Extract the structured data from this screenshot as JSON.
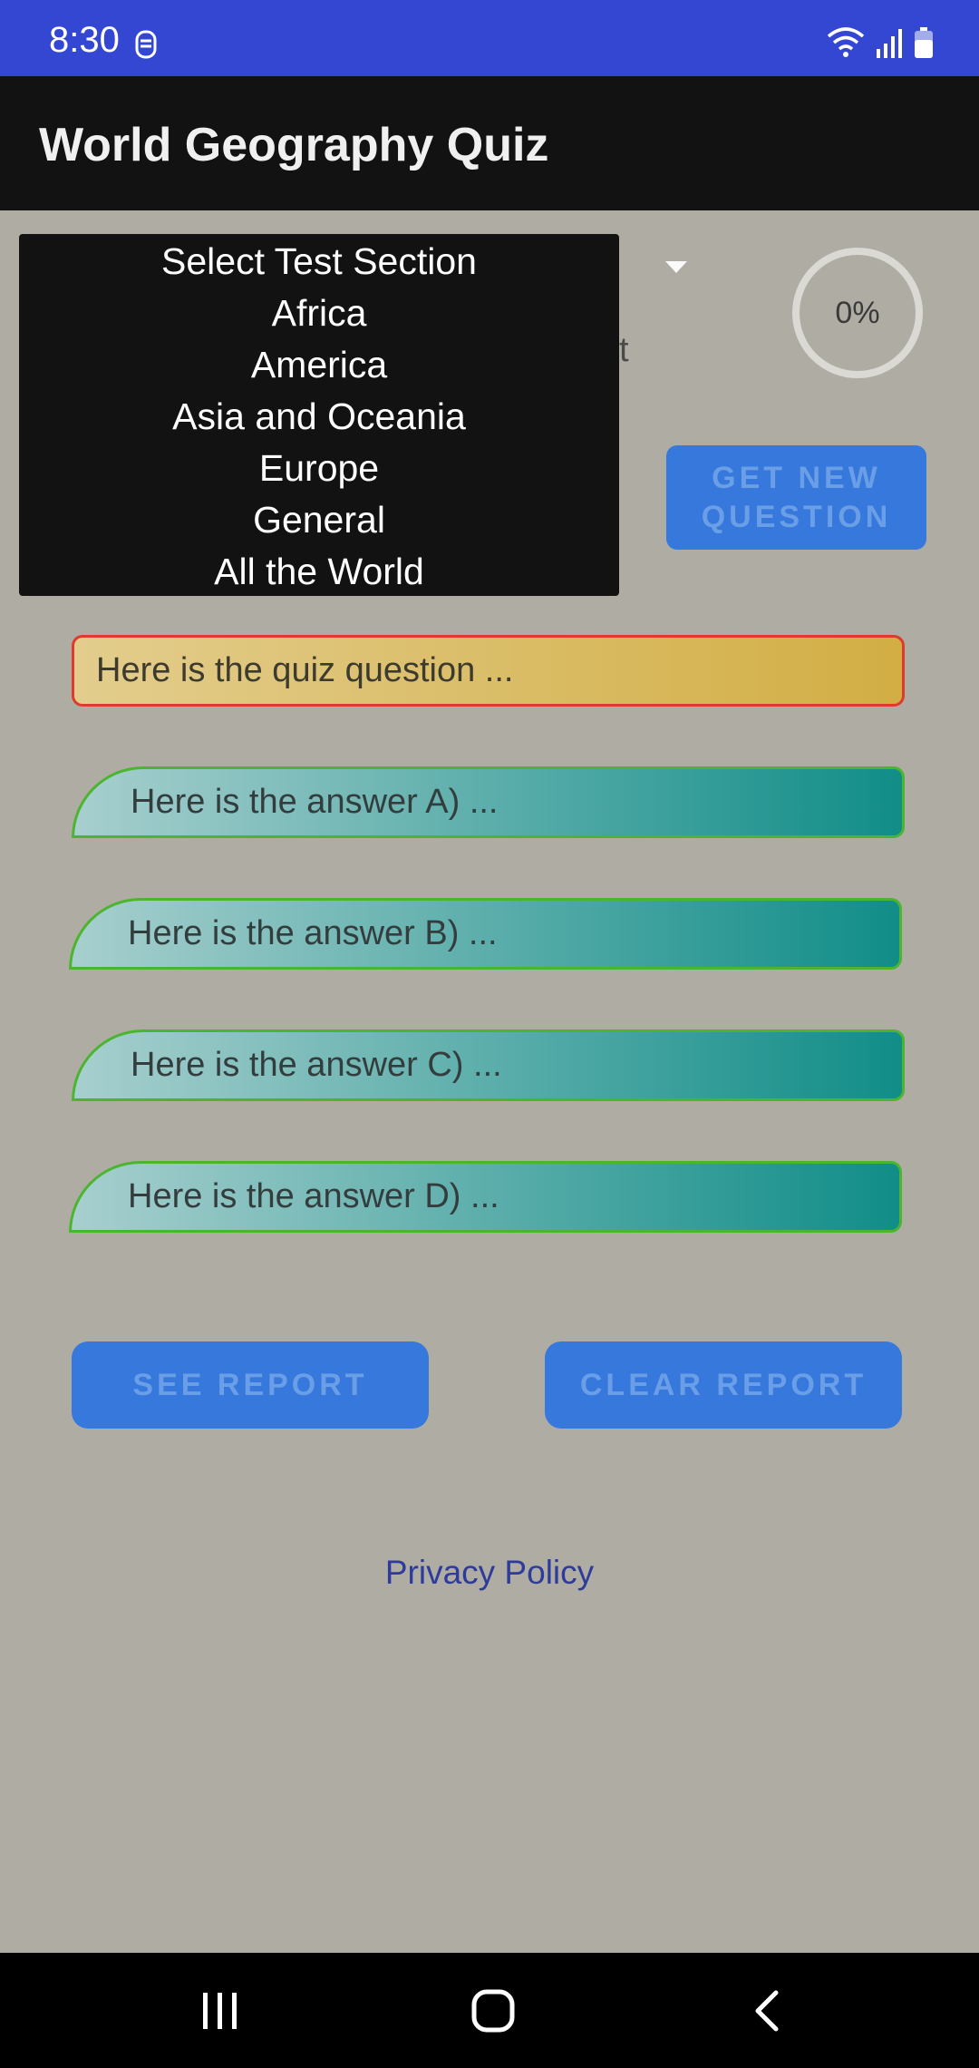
{
  "status_bar": {
    "time": "8:30",
    "icons": [
      "sync-icon",
      "wifi-icon",
      "signal-icon",
      "battery-icon"
    ]
  },
  "app_bar": {
    "title": "World Geography Quiz"
  },
  "section_spinner": {
    "partial_label": "st",
    "dropdown_options": [
      "Select Test Section",
      "Africa",
      "America",
      "Asia and Oceania",
      "Europe",
      "General",
      "All the World"
    ]
  },
  "progress": {
    "label": "0%",
    "value_percent": 0
  },
  "buttons": {
    "get_new_question": "GET NEW QUESTION",
    "see_report": "SEE REPORT",
    "clear_report": "CLEAR REPORT"
  },
  "quiz": {
    "question": "Here is the quiz question ...",
    "answers": [
      "Here is the answer A) ...",
      "Here is the answer B) ...",
      "Here is the answer C) ...",
      "Here is the answer D) ..."
    ]
  },
  "footer": {
    "privacy_link": "Privacy Policy"
  },
  "colors": {
    "status_bar": "#3447d2",
    "app_bar": "#121212",
    "background": "#afada3",
    "button": "#3678dc",
    "question_border": "#e03a2e",
    "answer_border": "#4cb530"
  },
  "nav_bar": {
    "icons": [
      "recent-apps-icon",
      "home-icon",
      "back-icon"
    ]
  }
}
